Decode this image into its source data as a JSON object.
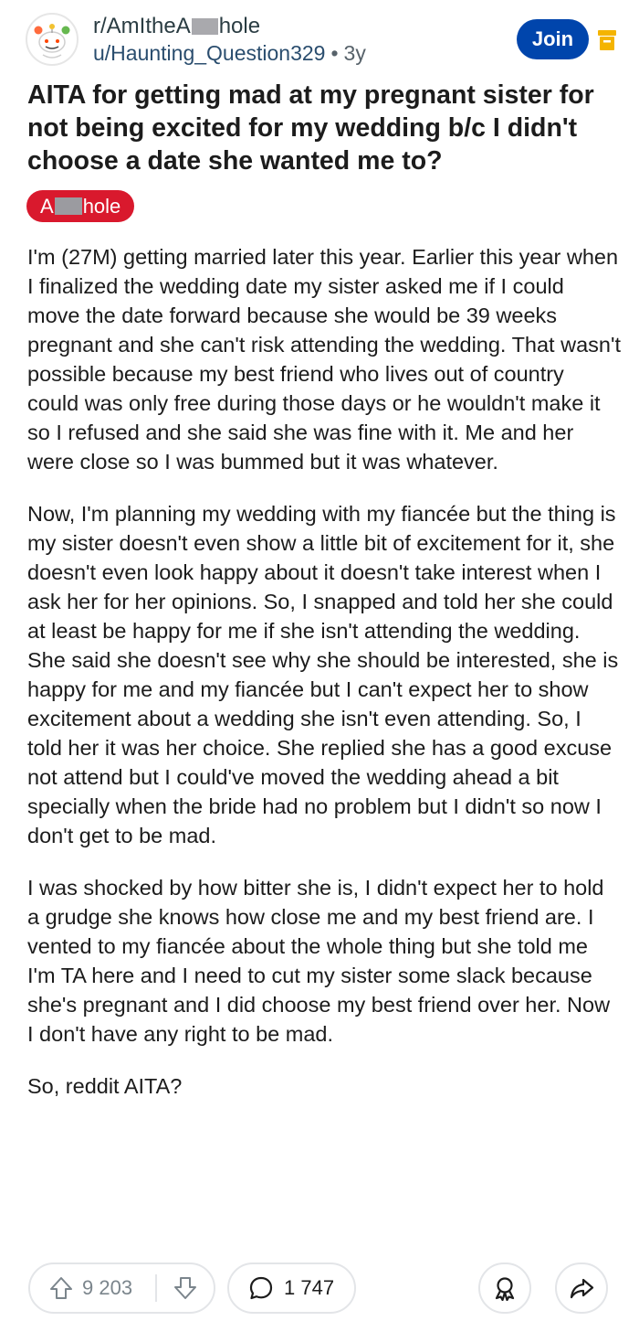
{
  "header": {
    "subreddit_prefix": "r/AmItheA",
    "subreddit_suffix": "hole",
    "username": "u/Haunting_Question329",
    "separator": "•",
    "age": "3y",
    "join_label": "Join"
  },
  "post": {
    "title": "AITA for getting mad at my pregnant sister for not being excited for my wedding b/c I didn't choose a date she wanted me to?",
    "flair_prefix": "A",
    "flair_suffix": "hole",
    "flair_color": "#d9192d",
    "paragraphs": [
      "I'm (27M) getting married later this year. Earlier this year when I finalized the wedding date my sister asked me if I could move the date forward because she would be 39 weeks pregnant and she can't risk attending the wedding. That wasn't possible because my best friend who lives out of country could was only free during those days or he wouldn't make it so I refused and she said she was fine with it. Me and her were close so I was bummed but it was whatever.",
      "Now, I'm planning my wedding with my fiancée but the thing is my sister doesn't even show a little bit of excitement for it, she doesn't even look happy about it doesn't take interest when I ask her for her opinions. So, I snapped and told her she could at least be happy for me if she isn't attending the wedding. She said she doesn't see why she should be interested, she is happy for me and my fiancée but I can't expect her to show excitement about a wedding she isn't even attending. So, I told her it was her choice. She replied she has a good excuse not attend but I could've moved the wedding ahead a bit specially when the bride had no problem but I didn't so now I don't get to be mad.",
      "I was shocked by how bitter she is, I didn't expect her to hold a grudge she knows how close me and my best friend are. I vented to my fiancée about the whole thing but she told me I'm TA here and I need to cut my sister some slack because she's pregnant and I did choose my best friend over her. Now I don't have any right to be mad.",
      "So, reddit AITA?"
    ]
  },
  "actions": {
    "upvote_count": "9 203",
    "comment_count": "1 747"
  },
  "icons": {
    "avatar": "snoo-avatar-icon",
    "archive": "archive-icon",
    "upvote": "arrow-up-icon",
    "downvote": "arrow-down-icon",
    "comment": "comment-bubble-icon",
    "award": "award-icon",
    "share": "share-icon"
  },
  "colors": {
    "join_button": "#0045ac",
    "archive_icon": "#f4b400",
    "username": "#2a4d6e"
  }
}
